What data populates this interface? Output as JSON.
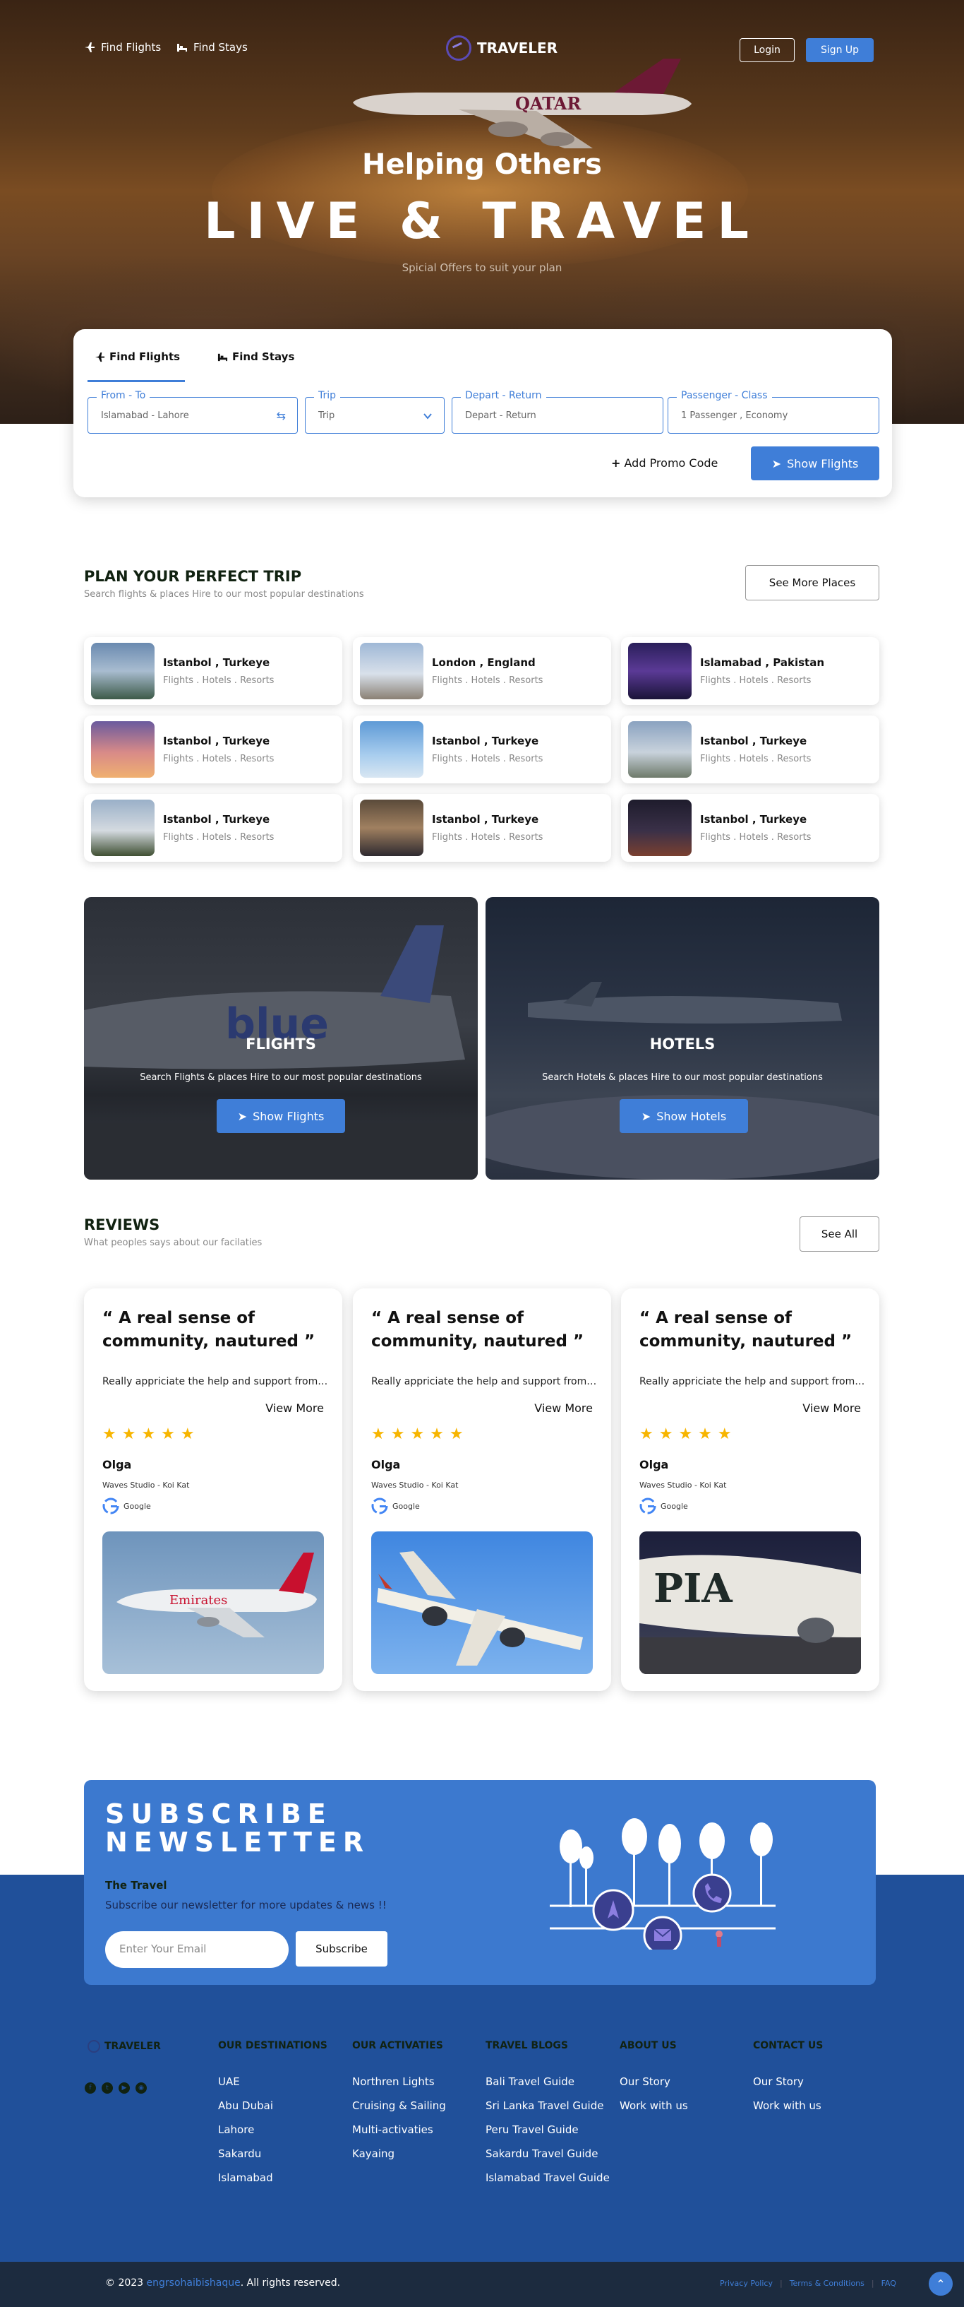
{
  "nav": {
    "find_flights": "Find Flights",
    "find_stays": "Find Stays",
    "brand": "TRAVELER",
    "login": "Login",
    "signup": "Sign Up"
  },
  "hero": {
    "subtitle": "Helping Others",
    "title": "LIVE & TRAVEL",
    "tagline": "Spicial Offers to suit your plan",
    "plane_text": "QATAR"
  },
  "search": {
    "tabs": [
      "Find Flights",
      "Find Stays"
    ],
    "fields": [
      {
        "label": "From - To",
        "value": "Islamabad - Lahore"
      },
      {
        "label": "Trip",
        "value": "Trip"
      },
      {
        "label": "Depart - Return",
        "value": "Depart - Return"
      },
      {
        "label": "Passenger - Class",
        "value": "1 Passenger , Economy"
      }
    ],
    "promo": "Add Promo Code",
    "show_flights": "Show Flights"
  },
  "plan": {
    "title": "PLAN YOUR PERFECT TRIP",
    "subtitle": "Search flights & places Hire to our most popular destinations",
    "see_more": "See More Places",
    "destinations": [
      {
        "name": "Istanbol , Turkeye",
        "types": "Flights . Hotels . Resorts"
      },
      {
        "name": "London , England",
        "types": "Flights . Hotels . Resorts"
      },
      {
        "name": "Islamabad , Pakistan",
        "types": "Flights . Hotels . Resorts"
      },
      {
        "name": "Istanbol , Turkeye",
        "types": "Flights . Hotels . Resorts"
      },
      {
        "name": "Istanbol , Turkeye",
        "types": "Flights . Hotels . Resorts"
      },
      {
        "name": "Istanbol , Turkeye",
        "types": "Flights . Hotels . Resorts"
      },
      {
        "name": "Istanbol , Turkeye",
        "types": "Flights . Hotels . Resorts"
      },
      {
        "name": "Istanbol , Turkeye",
        "types": "Flights . Hotels . Resorts"
      },
      {
        "name": "Istanbol , Turkeye",
        "types": "Flights . Hotels . Resorts"
      }
    ]
  },
  "promos": {
    "flights": {
      "title": "FLIGHTS",
      "subtitle": "Search Flights & places Hire to our most popular destinations",
      "button": "Show Flights",
      "plane_text": "blue"
    },
    "hotels": {
      "title": "HOTELS",
      "subtitle": "Search Hotels & places Hire to our most popular destinations",
      "button": "Show Hotels"
    }
  },
  "reviews": {
    "title": "REVIEWS",
    "subtitle": "What peoples says about our facilaties",
    "see_all": "See All",
    "items": [
      {
        "quote": "“ A real sense of community, nautured ”",
        "text": "Really appriciate the help and support from the staff",
        "view_more": "View More",
        "stars": "★★★★★",
        "author": "Olga",
        "company": "Waves Studio - Koi Kat",
        "source": "Google",
        "photo_text": "Emirates"
      },
      {
        "quote": "“ A real sense of community, nautured ”",
        "text": "Really appriciate the help and support from the staff",
        "view_more": "View More",
        "stars": "★★★★★",
        "author": "Olga",
        "company": "Waves Studio - Koi Kat",
        "source": "Google",
        "photo_text": ""
      },
      {
        "quote": "“ A real sense of community, nautured ”",
        "text": "Really appriciate the help and support from the staff",
        "view_more": "View More",
        "stars": "★★★★★",
        "author": "Olga",
        "company": "Waves Studio - Koi Kat",
        "source": "Google",
        "photo_text": "PIA"
      }
    ]
  },
  "newsletter": {
    "title_line1": "SUBSCRIBE",
    "title_line2": "NEWSLETTER",
    "heading": "The Travel",
    "subtitle": "Subscribe our newsletter for more updates & news !!",
    "placeholder": "Enter Your Email",
    "button": "Subscribe"
  },
  "footer": {
    "brand": "TRAVELER",
    "columns": [
      {
        "title": "OUR DESTINATIONS",
        "items": [
          "UAE",
          "Abu Dubai",
          "Lahore",
          "Sakardu",
          "Islamabad"
        ]
      },
      {
        "title": "OUR ACTIVATIES",
        "items": [
          "Northren Lights",
          "Cruising & Sailing",
          "Multi-activaties",
          "Kayaing"
        ]
      },
      {
        "title": "TRAVEL BLOGS",
        "items": [
          "Bali Travel Guide",
          "Sri Lanka Travel Guide",
          "Peru Travel Guide",
          "Sakardu Travel Guide",
          "Islamabad Travel Guide"
        ]
      },
      {
        "title": "ABOUT US",
        "items": [
          "Our Story",
          "Work with us"
        ]
      },
      {
        "title": "CONTACT US",
        "items": [
          "Our Story",
          "Work with us"
        ]
      }
    ],
    "copyright_prefix": "© 2023 ",
    "copyright_author": "engrsohaibishaque",
    "copyright_suffix": ". All rights reserved.",
    "links": [
      "Privacy Policy",
      "Terms & Conditions",
      "FAQ"
    ]
  },
  "colors": {
    "accent": "#3f7ed8",
    "footer": "#20509a",
    "newsletter": "#3c79cf",
    "stars": "#f7b500"
  }
}
